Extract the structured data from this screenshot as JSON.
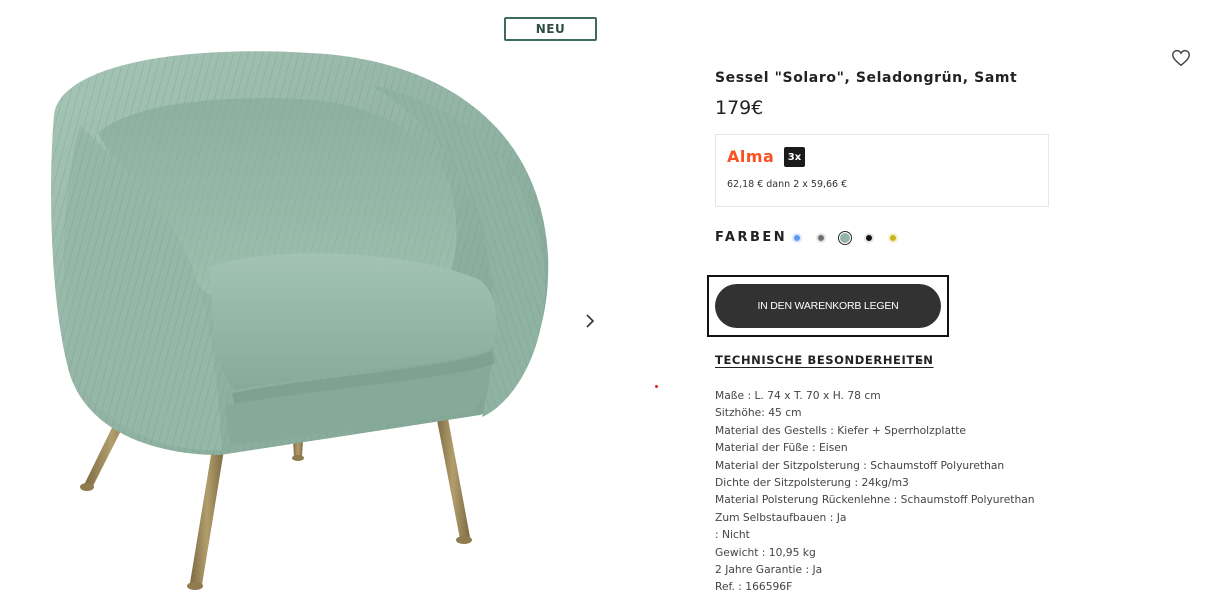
{
  "gallery": {
    "badge": "NEU",
    "next_icon": "chevron-right-icon",
    "image_alt_colors": {
      "velvet": "#8fb3a3",
      "legs": "#a08a5a"
    }
  },
  "wishlist_icon": "heart-outline-icon",
  "product": {
    "title": "Sessel \"Solaro\", Seladongrün, Samt",
    "price": "179€"
  },
  "alma": {
    "logo": "Alma",
    "badge": "3x",
    "installments": "62,18 € dann 2 x 59,66 €",
    "brand_color": "#fa5022"
  },
  "colors": {
    "label": "FARBEN",
    "swatches": [
      {
        "name": "blue",
        "hex": "#5b9bf0",
        "selected": false
      },
      {
        "name": "grey",
        "hex": "#6e6e6e",
        "selected": false
      },
      {
        "name": "seladon",
        "hex": "#93b5a8",
        "selected": true
      },
      {
        "name": "black",
        "hex": "#111111",
        "selected": false
      },
      {
        "name": "mustard",
        "hex": "#c8b41a",
        "selected": false
      }
    ]
  },
  "cart": {
    "label": "IN DEN WARENKORB LEGEN"
  },
  "technical": {
    "heading": "TECHNISCHE BESONDERHEITEN",
    "toggle": "-",
    "specs": [
      "Maße : L. 74 x T. 70 x H. 78 cm",
      "Sitzhöhe: 45 cm",
      "Material des Gestells : Kiefer + Sperrholzplatte",
      "Material der Füße : Eisen",
      "Material der Sitzpolsterung : Schaumstoff Polyurethan",
      "Dichte der Sitzpolsterung : 24kg/m3",
      "Material Polsterung Rückenlehne : Schaumstoff Polyurethan",
      "Zum Selbstaufbauen : Ja",
      " : Nicht",
      "Gewicht : 10,95 kg",
      "2 Jahre Garantie : Ja",
      "Ref. : 166596F"
    ]
  }
}
